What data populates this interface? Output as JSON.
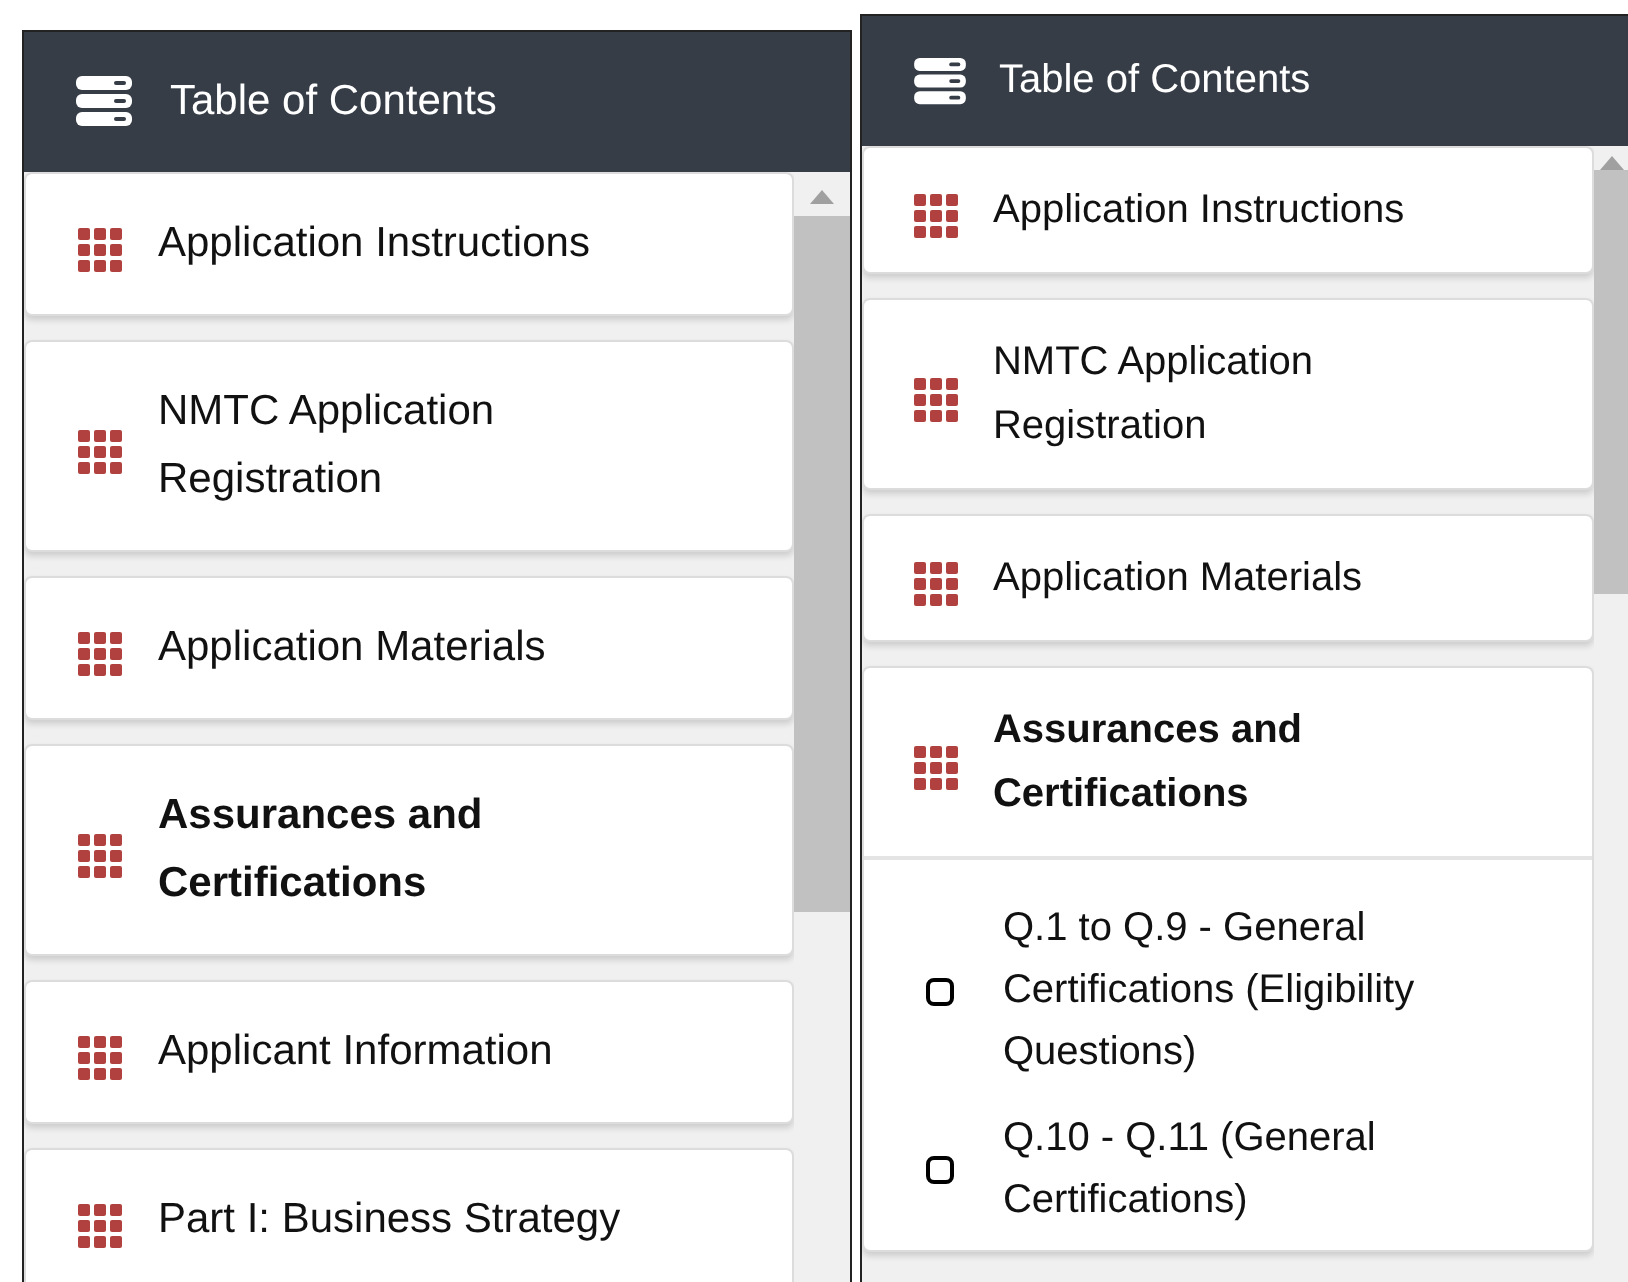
{
  "panels": [
    {
      "title": "Table of Contents",
      "items": [
        {
          "label": "Application Instructions",
          "selected": false,
          "expanded": false
        },
        {
          "label": "NMTC Application Registration",
          "selected": false,
          "expanded": false
        },
        {
          "label": "Application Materials",
          "selected": false,
          "expanded": false
        },
        {
          "label": "Assurances and Certifications",
          "selected": true,
          "expanded": false
        },
        {
          "label": "Applicant Information",
          "selected": false,
          "expanded": false
        },
        {
          "label": "Part I: Business Strategy",
          "selected": false,
          "expanded": false
        }
      ]
    },
    {
      "title": "Table of Contents",
      "items": [
        {
          "label": "Application Instructions",
          "selected": false,
          "expanded": false
        },
        {
          "label": "NMTC Application Registration",
          "selected": false,
          "expanded": false
        },
        {
          "label": "Application Materials",
          "selected": false,
          "expanded": false
        },
        {
          "label": "Assurances and Certifications",
          "selected": true,
          "expanded": true,
          "children": [
            {
              "label": "Q.1 to Q.9 - General Certifications (Eligibility Questions)",
              "checked": false
            },
            {
              "label": "Q.10 - Q.11 (General Certifications)",
              "checked": false
            }
          ]
        }
      ]
    }
  ]
}
